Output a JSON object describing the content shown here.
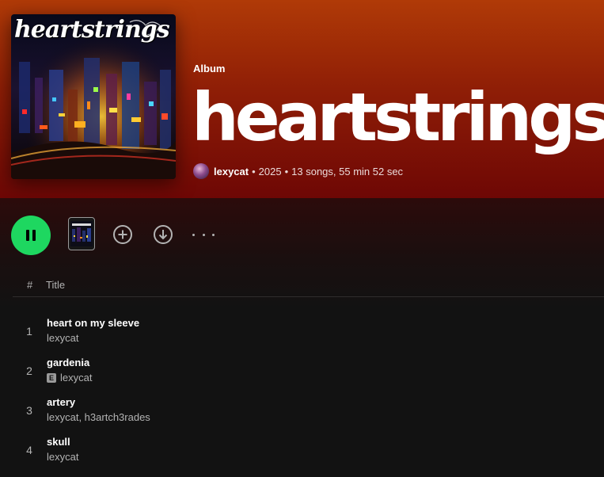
{
  "album": {
    "type_label": "Album",
    "title": "heartstrings",
    "cover_text": "heartstrings",
    "artist": "lexycat",
    "year": "2025",
    "stats": "13 songs, 55 min 52 sec",
    "separator": "•"
  },
  "colors": {
    "header_gradient_top": "#b03a07",
    "header_gradient_bottom": "#6e0705",
    "play_button": "#1ed760",
    "background": "#121212",
    "secondary_text": "#b3b3b3"
  },
  "actions": {
    "play_state": "pause",
    "play_icon": "pause-icon",
    "add_icon": "add-to-library-icon",
    "download_icon": "download-icon",
    "more_icon": "more-options-icon"
  },
  "track_list": {
    "columns": {
      "number": "#",
      "title": "Title"
    },
    "tracks": [
      {
        "number": "1",
        "title": "heart on my sleeve",
        "artists": "lexycat",
        "explicit": false
      },
      {
        "number": "2",
        "title": "gardenia",
        "artists": "lexycat",
        "explicit": true,
        "explicit_label": "E"
      },
      {
        "number": "3",
        "title": "artery",
        "artists": "lexycat, h3artch3rades",
        "explicit": false
      },
      {
        "number": "4",
        "title": "skull",
        "artists": "lexycat",
        "explicit": false
      }
    ]
  }
}
